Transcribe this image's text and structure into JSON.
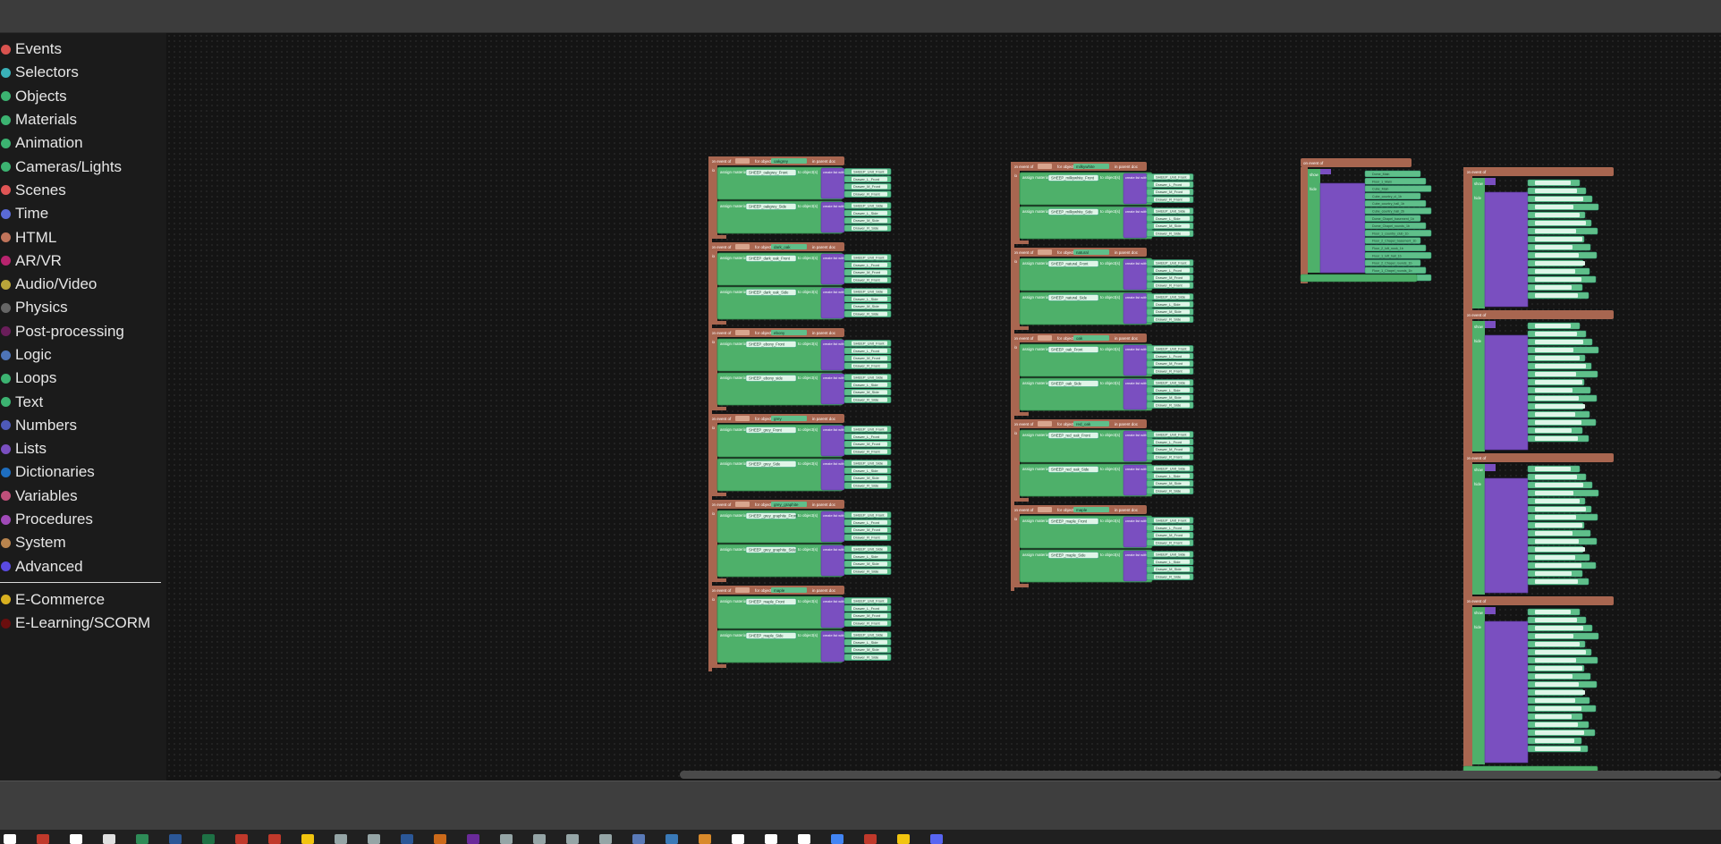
{
  "toolbox": {
    "categories": [
      {
        "label": "Events",
        "color": "#d9534f",
        "icon": "events-dot"
      },
      {
        "label": "Selectors",
        "color": "#3ab1b8",
        "icon": "selectors-dot"
      },
      {
        "label": "Objects",
        "color": "#3cb371",
        "icon": "objects-dot"
      },
      {
        "label": "Materials",
        "color": "#3cb371",
        "icon": "materials-dot"
      },
      {
        "label": "Animation",
        "color": "#3cb371",
        "icon": "animation-dot"
      },
      {
        "label": "Cameras/Lights",
        "color": "#3cb371",
        "icon": "cameras-dot"
      },
      {
        "label": "Scenes",
        "color": "#e05555",
        "icon": "scenes-dot"
      },
      {
        "label": "Time",
        "color": "#5a6ad6",
        "icon": "time-dot"
      },
      {
        "label": "HTML",
        "color": "#c0745a",
        "icon": "html-dot"
      },
      {
        "label": "AR/VR",
        "color": "#b8246e",
        "icon": "arvr-dot"
      },
      {
        "label": "Audio/Video",
        "color": "#b8a43a",
        "icon": "audio-dot"
      },
      {
        "label": "Physics",
        "color": "#666666",
        "icon": "physics-dot"
      },
      {
        "label": "Post-processing",
        "color": "#6a1e5a",
        "icon": "post-dot"
      },
      {
        "label": "Logic",
        "color": "#4e74b8",
        "icon": "logic-dot"
      },
      {
        "label": "Loops",
        "color": "#3cb371",
        "icon": "loops-dot"
      },
      {
        "label": "Text",
        "color": "#3cb371",
        "icon": "text-dot"
      },
      {
        "label": "Numbers",
        "color": "#4e5ab8",
        "icon": "numbers-dot"
      },
      {
        "label": "Lists",
        "color": "#7a4fc0",
        "icon": "lists-dot"
      },
      {
        "label": "Dictionaries",
        "color": "#1e6ec0",
        "icon": "dict-dot"
      },
      {
        "label": "Variables",
        "color": "#c0507a",
        "icon": "variables-dot"
      },
      {
        "label": "Procedures",
        "color": "#a04ab8",
        "icon": "procedures-dot"
      },
      {
        "label": "System",
        "color": "#b8844e",
        "icon": "system-dot"
      },
      {
        "label": "Advanced",
        "color": "#5a4ae0",
        "icon": "advanced-dot"
      }
    ],
    "extras": [
      {
        "label": "E-Commerce",
        "color": "#d9b020",
        "icon": "ecommerce-dot"
      },
      {
        "label": "E-Learning/SCORM",
        "color": "#6a0e0e",
        "icon": "elearning-dot"
      }
    ]
  },
  "workspace": {
    "event_label": "on event of",
    "for_object_label": "for object",
    "in_parent_doc_label": "in parent doc",
    "assign_material_label": "assign material",
    "to_objects_label": "to object(s)",
    "create_list_label": "create list with",
    "do_label": "do",
    "show_label": "show",
    "hide_label": "hide",
    "columns": [
      {
        "groups": [
          {
            "object": "oakgrey",
            "front": "SHEEP_oakgrey_Front",
            "side": "SHEEP_oakgrey_Side"
          },
          {
            "object": "dark_oak",
            "front": "SHEEP_dark_oak_Front",
            "side": "SHEEP_dark_oak_Side"
          },
          {
            "object": "ebony",
            "front": "SHEEP_ebony_Front",
            "side": "SHEEP_ebony_side"
          },
          {
            "object": "grey",
            "front": "SHEEP_grey_Front",
            "side": "SHEEP_grey_Side"
          },
          {
            "object": "grey_graphite",
            "front": "SHEEP_grey_graphite_Front",
            "side": "SHEEP_grey_graphite_Side"
          },
          {
            "object": "maple",
            "front": "SHEEP_maple_Front",
            "side": "SHEEP_maple_Side"
          }
        ]
      },
      {
        "groups": [
          {
            "object": "milkywhite",
            "front": "SHEEP_milkywhite_Front",
            "side": "SHEEP_milkywhite_Side"
          },
          {
            "object": "natural",
            "front": "SHEEP_natural_Front",
            "side": "SHEEP_natural_Side"
          },
          {
            "object": "oak",
            "front": "SHEEP_oak_Front",
            "side": "SHEEP_oak_Side"
          },
          {
            "object": "red_oak",
            "front": "SHEEP_red_oak_Front",
            "side": "SHEEP_red_oak_Side"
          },
          {
            "object": "maple",
            "front": "SHEEP_maple_Front",
            "side": "SHEEP_maple_Side"
          }
        ]
      }
    ]
  },
  "scrollbar": {
    "position": 0.33
  },
  "taskbar": {
    "icons": [
      "windows-icon",
      "app-icon",
      "doc-icon",
      "calc-icon",
      "chart-icon",
      "word-icon",
      "excel-icon",
      "pdf-icon",
      "media-icon",
      "notes-icon",
      "files-icon",
      "settings-icon",
      "ps-icon",
      "ai-icon",
      "pr-icon",
      "app2-icon",
      "app3-icon",
      "app4-icon",
      "steam-icon",
      "app5-icon",
      "app6-icon",
      "app7-icon",
      "app8-icon",
      "app9-icon",
      "app10-icon",
      "chrome-icon",
      "app11-icon",
      "folder-icon",
      "discord-icon"
    ]
  }
}
